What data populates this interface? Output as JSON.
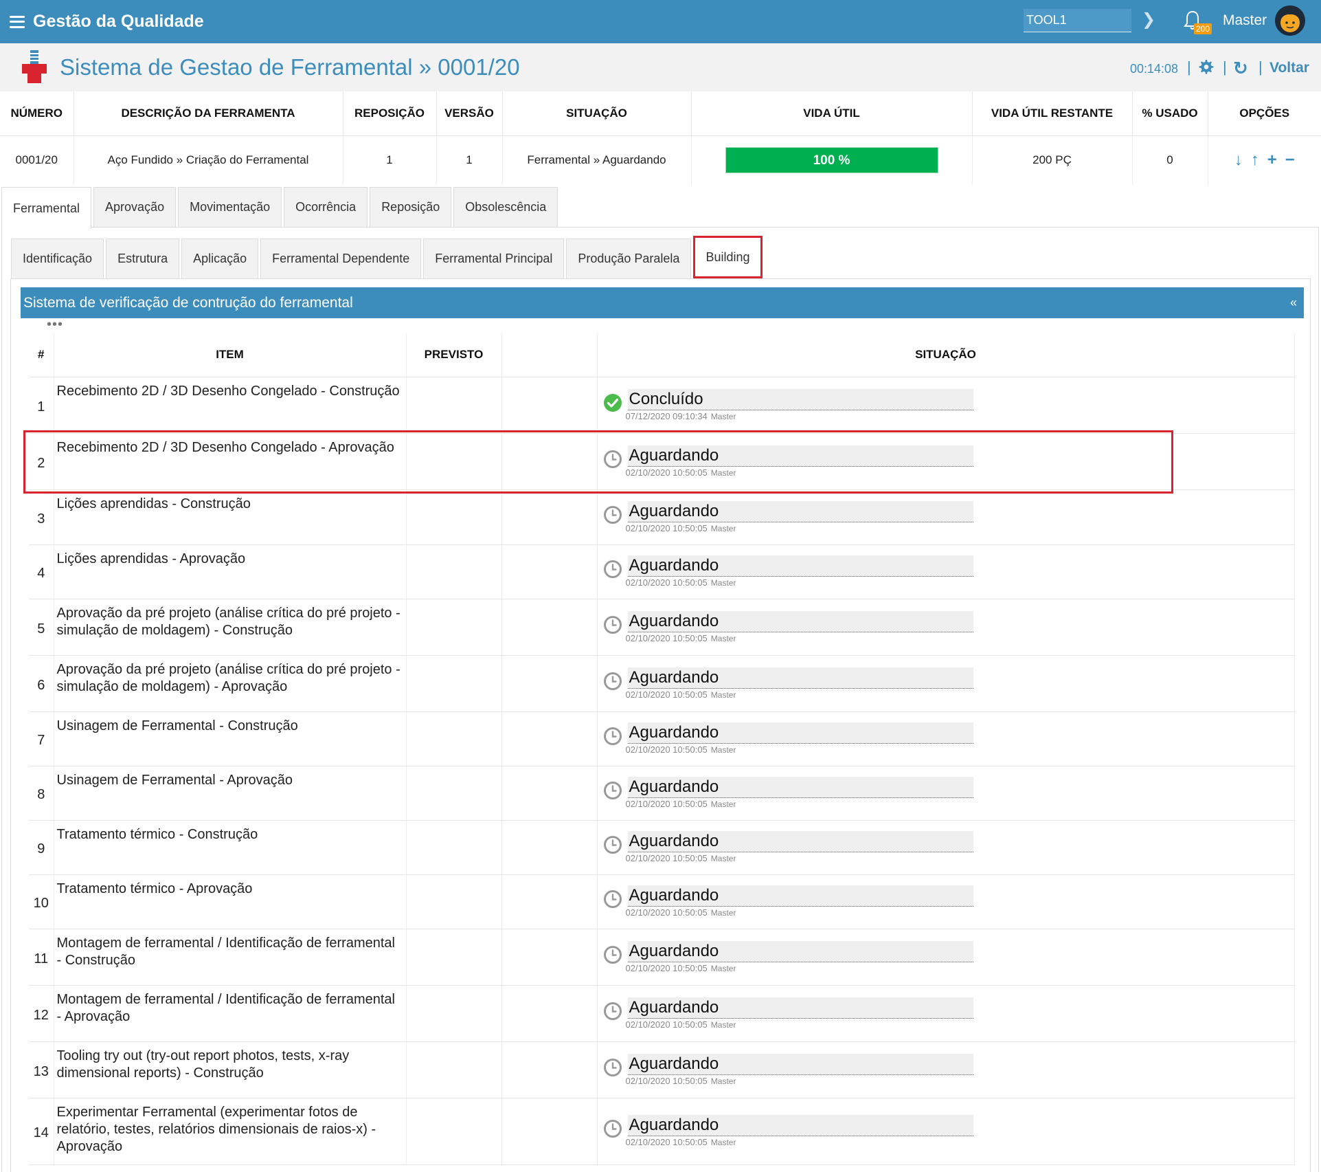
{
  "app": {
    "title": "Gestão da Qualidade",
    "tool_value": "TOOL1",
    "notification_count": "200",
    "user": "Master"
  },
  "header": {
    "title": "Sistema de Gestao de Ferramental » 0001/20",
    "timer": "00:14:08",
    "back_label": "Voltar"
  },
  "summary": {
    "columns": [
      "NÚMERO",
      "DESCRIÇÃO DA FERRAMENTA",
      "REPOSIÇÃO",
      "VERSÃO",
      "SITUAÇÃO",
      "VIDA ÚTIL",
      "VIDA ÚTIL RESTANTE",
      "% USADO",
      "OPÇÕES"
    ],
    "row": {
      "numero": "0001/20",
      "descricao": "Aço Fundido » Criação do Ferramental",
      "reposicao": "1",
      "versao": "1",
      "situacao": "Ferramental » Aguardando",
      "vida_util": "100 %",
      "vida_util_percent": 100,
      "vida_util_restante": "200 PÇ",
      "usado": "0"
    }
  },
  "tabs": [
    "Ferramental",
    "Aprovação",
    "Movimentação",
    "Ocorrência",
    "Reposição",
    "Obsolescência"
  ],
  "active_tab": "Ferramental",
  "subtabs": [
    "Identificação",
    "Estrutura",
    "Aplicação",
    "Ferramental Dependente",
    "Ferramental Principal",
    "Produção Paralela",
    "Building"
  ],
  "active_subtab": "Building",
  "section": {
    "title": "Sistema de verificação de contrução do ferramental",
    "collapse_label": "«",
    "columns": {
      "num": "#",
      "item": "ITEM",
      "previsto": "PREVISTO",
      "situacao": "SITUAÇÃO"
    },
    "rows": [
      {
        "num": "1",
        "item": "Recebimento 2D / 3D Desenho Congelado - Construção",
        "status": "Concluído",
        "date": "07/12/2020 09:10:34",
        "user": "Master",
        "done": true
      },
      {
        "num": "2",
        "item": "Recebimento 2D / 3D Desenho Congelado - Aprovação",
        "status": "Aguardando",
        "date": "02/10/2020 10:50:05",
        "user": "Master",
        "done": false
      },
      {
        "num": "3",
        "item": "Lições aprendidas - Construção",
        "status": "Aguardando",
        "date": "02/10/2020 10:50:05",
        "user": "Master",
        "done": false
      },
      {
        "num": "4",
        "item": "Lições aprendidas - Aprovação",
        "status": "Aguardando",
        "date": "02/10/2020 10:50:05",
        "user": "Master",
        "done": false
      },
      {
        "num": "5",
        "item": "Aprovação da pré projeto (análise crítica do pré projeto - simulação de moldagem) - Construção",
        "status": "Aguardando",
        "date": "02/10/2020 10:50:05",
        "user": "Master",
        "done": false
      },
      {
        "num": "6",
        "item": "Aprovação da pré projeto (análise crítica do pré projeto - simulação de moldagem) - Aprovação",
        "status": "Aguardando",
        "date": "02/10/2020 10:50:05",
        "user": "Master",
        "done": false
      },
      {
        "num": "7",
        "item": "Usinagem de Ferramental - Construção",
        "status": "Aguardando",
        "date": "02/10/2020 10:50:05",
        "user": "Master",
        "done": false
      },
      {
        "num": "8",
        "item": "Usinagem de Ferramental - Aprovação",
        "status": "Aguardando",
        "date": "02/10/2020 10:50:05",
        "user": "Master",
        "done": false
      },
      {
        "num": "9",
        "item": "Tratamento térmico - Construção",
        "status": "Aguardando",
        "date": "02/10/2020 10:50:05",
        "user": "Master",
        "done": false
      },
      {
        "num": "10",
        "item": "Tratamento térmico - Aprovação",
        "status": "Aguardando",
        "date": "02/10/2020 10:50:05",
        "user": "Master",
        "done": false
      },
      {
        "num": "11",
        "item": "Montagem de ferramental / Identificação de ferramental - Construção",
        "status": "Aguardando",
        "date": "02/10/2020 10:50:05",
        "user": "Master",
        "done": false
      },
      {
        "num": "12",
        "item": "Montagem de ferramental / Identificação de ferramental - Aprovação",
        "status": "Aguardando",
        "date": "02/10/2020 10:50:05",
        "user": "Master",
        "done": false
      },
      {
        "num": "13",
        "item": "Tooling try out (try-out report photos, tests, x-ray dimensional reports) - Construção",
        "status": "Aguardando",
        "date": "02/10/2020 10:50:05",
        "user": "Master",
        "done": false
      },
      {
        "num": "14",
        "item": "Experimentar Ferramental (experimentar fotos de relatório, testes, relatórios dimensionais de raios-x) - Aprovação",
        "status": "Aguardando",
        "date": "02/10/2020 10:50:05",
        "user": "Master",
        "done": false
      }
    ]
  },
  "colors": {
    "primary": "#3c8dbc",
    "success": "#00b050",
    "highlight": "#d9232e"
  }
}
